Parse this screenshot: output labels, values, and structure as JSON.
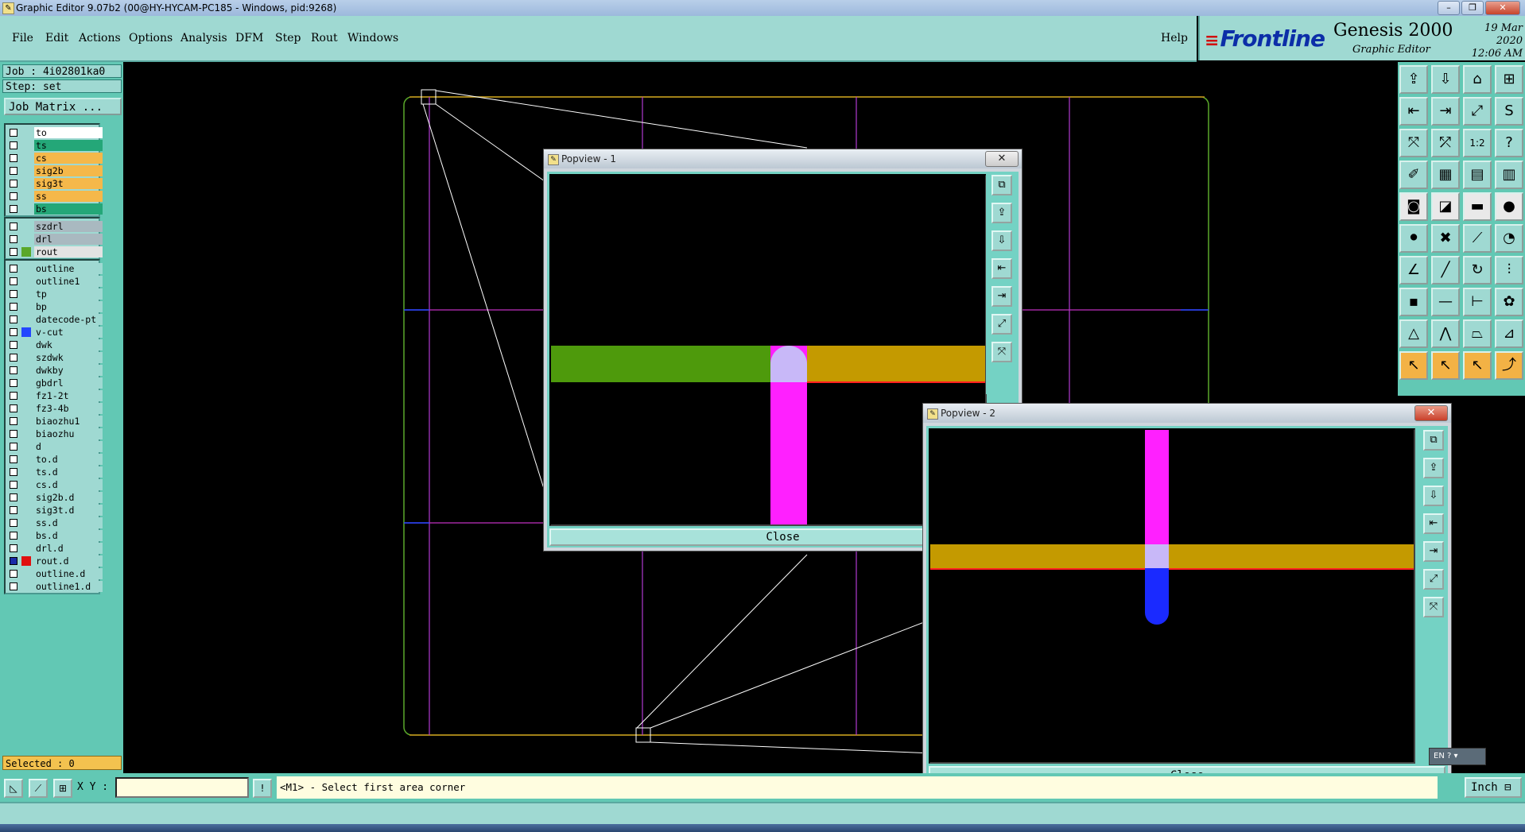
{
  "window": {
    "title": "Graphic Editor 9.07b2 (00@HY-HYCAM-PC185 - Windows, pid:9268)",
    "minimize": "–",
    "restore": "❐",
    "close": "✕"
  },
  "menu": {
    "file": "File",
    "edit": "Edit",
    "actions": "Actions",
    "options": "Options",
    "analysis": "Analysis",
    "dfm": "DFM",
    "step": "Step",
    "rout": "Rout",
    "windows": "Windows",
    "help": "Help"
  },
  "brand": {
    "logo": "Frontline",
    "product": "Genesis 2000",
    "subtitle": "Graphic Editor",
    "date": "19 Mar 2020",
    "time": "12:06 AM"
  },
  "job": {
    "job_line": "Job : 4i02801ka0",
    "step_line": "Step: set",
    "job_matrix": "Job Matrix ..."
  },
  "layers": {
    "group1": [
      {
        "name": "to",
        "bg": "#ffffff"
      },
      {
        "name": "ts",
        "bg": "#24a778"
      },
      {
        "name": "cs",
        "bg": "#f5b84a"
      },
      {
        "name": "sig2b",
        "bg": "#f5b84a"
      },
      {
        "name": "sig3t",
        "bg": "#f5b84a"
      },
      {
        "name": "ss",
        "bg": "#f5b84a"
      },
      {
        "name": "bs",
        "bg": "#24a778"
      }
    ],
    "group2": [
      {
        "name": "szdrl",
        "bg": "#a9b9c0"
      },
      {
        "name": "drl",
        "bg": "#a9b9c0"
      },
      {
        "name": "rout",
        "bg": "#e3e3e3",
        "swatch": "#5aa82a"
      }
    ],
    "group3": [
      {
        "name": "outline"
      },
      {
        "name": "outline1"
      },
      {
        "name": "tp"
      },
      {
        "name": "bp"
      },
      {
        "name": "datecode-pt"
      },
      {
        "name": "v-cut",
        "swatch": "#2346ff"
      },
      {
        "name": "dwk"
      },
      {
        "name": "szdwk"
      },
      {
        "name": "dwkby"
      },
      {
        "name": "gbdrl"
      },
      {
        "name": "fz1-2t"
      },
      {
        "name": "fz3-4b"
      },
      {
        "name": "biaozhu1"
      },
      {
        "name": "biaozhu"
      },
      {
        "name": "d"
      },
      {
        "name": "to.d"
      },
      {
        "name": "ts.d"
      },
      {
        "name": "cs.d"
      },
      {
        "name": "sig2b.d"
      },
      {
        "name": "sig3t.d"
      },
      {
        "name": "ss.d"
      },
      {
        "name": "bs.d"
      },
      {
        "name": "drl.d"
      },
      {
        "name": "rout.d",
        "swatch": "#e01010",
        "checked": true
      },
      {
        "name": "outline.d"
      },
      {
        "name": "outline1.d"
      }
    ],
    "selected": "Selected : 0"
  },
  "popview1": {
    "title": "Popview - 1",
    "close_x": "✕",
    "close_button": "Close"
  },
  "popview2": {
    "title": "Popview - 2",
    "close_x": "✕",
    "close_button": "Close"
  },
  "bottom": {
    "xy_label": "X Y :",
    "xy_value": "",
    "status_message": "<M1> - Select first area corner",
    "unit": "Inch"
  },
  "ime": {
    "label": "EN"
  },
  "colors": {
    "panel": "#62c8b4",
    "panel_light": "#9fd9d2",
    "canvas": "#000000",
    "trace_green": "#4e9a0c",
    "trace_gold": "#c49a00",
    "trace_magenta": "#ff20ff",
    "trace_blue": "#1a2aff"
  },
  "icons": {
    "right_toolbar": [
      "open-icon",
      "save-icon",
      "home-icon",
      "grid-icon",
      "in-icon",
      "out-icon",
      "zoom-in-icon",
      "s-shape-icon",
      "fit-icon",
      "zoom-fit-icon",
      "ratio-icon",
      "help-icon",
      "measure-icon",
      "grid-snap-icon",
      "layers-icon",
      "filter-icon",
      "pad-icon",
      "rotate-icon",
      "dash-icon",
      "circle-icon",
      "node-icon",
      "cross-icon",
      "link-icon",
      "arc-icon",
      "angle-icon",
      "slash-icon",
      "rotate-cw-icon",
      "split-icon",
      "point-icon",
      "line-icon",
      "span-icon",
      "blob-icon",
      "triangle-icon",
      "arch-icon",
      "trapezoid-icon",
      "ramp-icon",
      "pointer-icon",
      "select-icon",
      "move-icon",
      "path-icon"
    ]
  }
}
